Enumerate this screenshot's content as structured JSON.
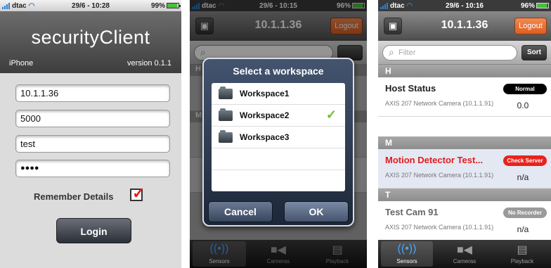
{
  "colors": {
    "accent_blue": "#2a93ff",
    "logout_orange": "#e8662a",
    "check_red": "#e8231d"
  },
  "status_bars": [
    {
      "carrier": "dtac",
      "time": "29/6 - 10:28",
      "battery": "99%"
    },
    {
      "carrier": "dtac",
      "time": "29/6 - 10:15",
      "battery": "96%"
    },
    {
      "carrier": "dtac",
      "time": "29/6 - 10:16",
      "battery": "96%"
    }
  ],
  "login": {
    "app_title": "securityClient",
    "device": "iPhone",
    "version": "version 0.1.1",
    "host": "10.1.1.36",
    "port": "5000",
    "username": "test",
    "password_mask": "●●●●",
    "remember_label": "Remember Details",
    "remember_checked": true,
    "login_label": "Login"
  },
  "workspace": {
    "nav_title": "10.1.1.36",
    "logout_label": "Logout",
    "dialog_title": "Select a workspace",
    "items": [
      {
        "name": "Workspace1",
        "selected": false
      },
      {
        "name": "Workspace2",
        "selected": true
      },
      {
        "name": "Workspace3",
        "selected": false
      }
    ],
    "cancel_label": "Cancel",
    "ok_label": "OK",
    "bg_letters": [
      "H",
      "M"
    ]
  },
  "sensors": {
    "nav_title": "10.1.1.36",
    "logout_label": "Logout",
    "filter_placeholder": "Filter",
    "sort_label": "Sort",
    "sections": [
      {
        "header": "H",
        "item": {
          "title": "Host Status",
          "subtitle": "AXIS 207 Network Camera (10.1.1.91)",
          "badge": "Normal",
          "badge_style": "black",
          "value": "0.0",
          "title_style": "normal"
        }
      },
      {
        "header": "M",
        "item": {
          "title": "Motion Detector Test...",
          "subtitle": "AXIS 207 Network Camera (10.1.1.91)",
          "badge": "Check Server",
          "badge_style": "red",
          "value": "n/a",
          "title_style": "red"
        }
      },
      {
        "header": "T",
        "item": {
          "title": "Test Cam 91",
          "subtitle": "AXIS 207 Network Camera (10.1.1.91)",
          "badge": "No Recorder",
          "badge_style": "grey",
          "value": "n/a",
          "title_style": "grey"
        }
      }
    ]
  },
  "tabs": [
    {
      "label": "Sensors",
      "icon": "sensor-wave-icon"
    },
    {
      "label": "Cameras",
      "icon": "video-camera-icon"
    },
    {
      "label": "Playback",
      "icon": "film-strip-icon"
    }
  ]
}
